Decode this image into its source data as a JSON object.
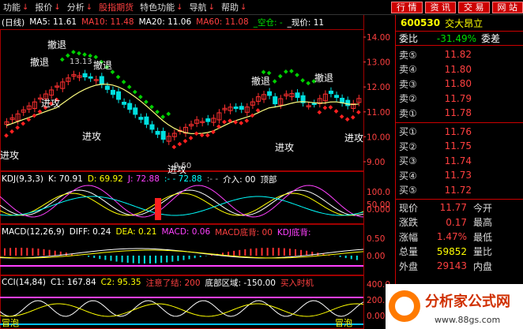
{
  "menubar": {
    "items": [
      {
        "label": "功能",
        "hot": false
      },
      {
        "label": "报价",
        "hot": false
      },
      {
        "label": "分析",
        "hot": false
      },
      {
        "label": "股指期货",
        "hot": true
      },
      {
        "label": "特色功能",
        "hot": false
      },
      {
        "label": "导航",
        "hot": false
      },
      {
        "label": "帮助",
        "hot": false
      }
    ],
    "right_buttons": [
      "行 情",
      "资 讯",
      "交 易",
      "网 站"
    ]
  },
  "main_legend": {
    "prefix": "(日线)",
    "ma5": "MA5: 11.61",
    "ma10": "MA10: 11.48",
    "ma20": "MA20: 11.06",
    "ma60": "MA60: 11.08",
    "status": "_空仓: -",
    "price": "_现价: 11"
  },
  "kdj_legend": {
    "name": "KDJ(9,3,3)",
    "k": "K: 70.91",
    "d": "D: 69.92",
    "j": "J: 72.88",
    "j2": ":- - 72.88",
    "cut": ":- -",
    "entry": "介入: 00",
    "top": "顶部"
  },
  "macd_legend": {
    "name": "MACD(12,26,9)",
    "diff": "DIFF: 0.24",
    "dea": "DEA: 0.21",
    "macd": "MACD: 0.06",
    "bottom": "MACD底背: 00",
    "kdj_bottom": "KDJ底背:"
  },
  "cci_legend": {
    "name": "CCI(14,84)",
    "c1": "C1: 167.84",
    "c2": "C2: 95.35",
    "note": "注意了结: 200",
    "zone": "底部区域: -150.00",
    "buy": "买入时机"
  },
  "annotations": {
    "retreat": "撤退",
    "attack": "进攻",
    "price_label_high": "13.13",
    "price_label_low": "9.50",
    "bottom_mark": "冒泡"
  },
  "axis": {
    "main": [
      "14.00",
      "13.00",
      "12.00",
      "11.00",
      "10.00",
      "9.00"
    ],
    "kdj": [
      "100.0",
      "50.00",
      "0.000"
    ],
    "macd": [
      "0.50",
      "0.00"
    ],
    "cci": [
      "400.0",
      "200.0",
      "0.000"
    ]
  },
  "quote": {
    "code": "600530",
    "name": "交大昂立",
    "ratio_label": "委比",
    "ratio_value": "-31.49%",
    "ratio_tail": "委差",
    "sells": [
      {
        "label": "卖⑤",
        "price": "11.82"
      },
      {
        "label": "卖④",
        "price": "11.80"
      },
      {
        "label": "卖③",
        "price": "11.80"
      },
      {
        "label": "卖②",
        "price": "11.79"
      },
      {
        "label": "卖①",
        "price": "11.78"
      }
    ],
    "buys": [
      {
        "label": "买①",
        "price": "11.76"
      },
      {
        "label": "买②",
        "price": "11.75"
      },
      {
        "label": "买③",
        "price": "11.74"
      },
      {
        "label": "买④",
        "price": "11.73"
      },
      {
        "label": "买⑤",
        "price": "11.72"
      }
    ],
    "stats": [
      {
        "label": "现价",
        "value": "11.77",
        "tail": "今开",
        "color": "red"
      },
      {
        "label": "涨跌",
        "value": "0.17",
        "tail": "最高",
        "color": "red"
      },
      {
        "label": "涨幅",
        "value": "1.47%",
        "tail": "最低",
        "color": "red"
      },
      {
        "label": "总量",
        "value": "59852",
        "tail": "量比",
        "color": "yel"
      },
      {
        "label": "外盘",
        "value": "29143",
        "tail": "内盘",
        "color": "red"
      }
    ]
  },
  "watermark": {
    "brand": "分析家公式网",
    "url": "www.88gs.com"
  },
  "colors": {
    "up": "#ff3030",
    "down": "#00e0e0",
    "ma_yellow": "#ffff80",
    "ma_dot_green": "#00d000",
    "ma_dot_red": "#ff2020",
    "grid_red": "#a00000"
  }
}
